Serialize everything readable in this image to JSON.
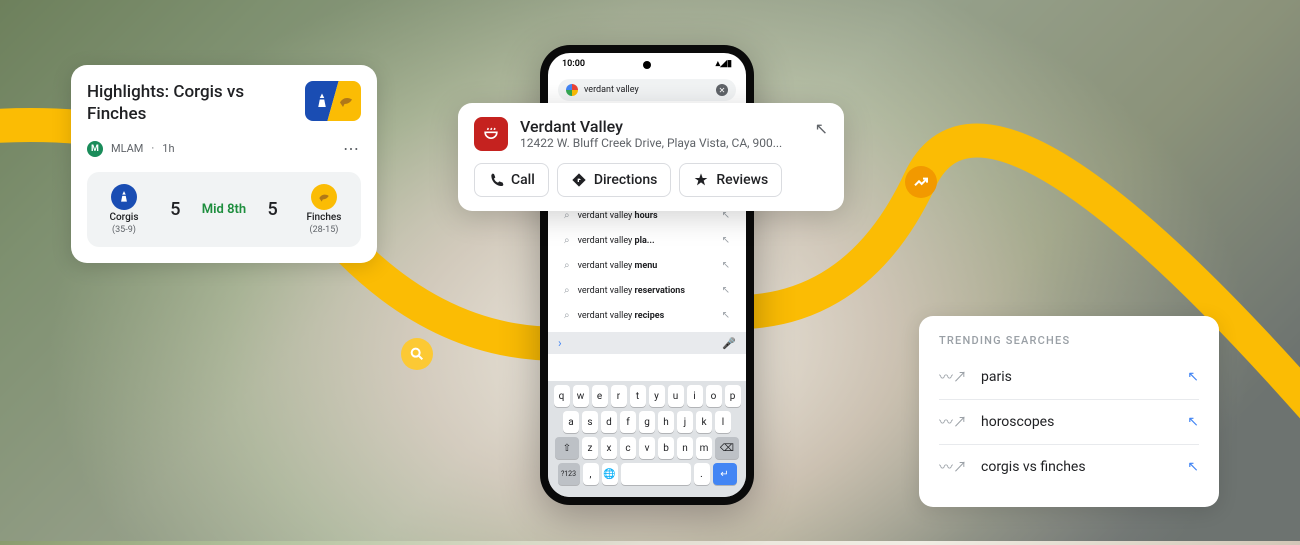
{
  "sports": {
    "title": "Highlights: Corgis vs Finches",
    "source": "MLAM",
    "time": "1h",
    "badge": "M",
    "status": "Mid 8th",
    "team1": {
      "name": "Corgis",
      "record": "(35-9)",
      "score": "5"
    },
    "team2": {
      "name": "Finches",
      "record": "(28-15)",
      "score": "5"
    }
  },
  "phone": {
    "time": "10:00",
    "search_value": "verdant valley",
    "suggestions": [
      {
        "prefix": "verdant valley ",
        "bold": "hours"
      },
      {
        "prefix": "verdant valley ",
        "bold": "pla..."
      },
      {
        "prefix": "verdant valley ",
        "bold": "menu"
      },
      {
        "prefix": "verdant valley ",
        "bold": "reservations"
      },
      {
        "prefix": "verdant valley ",
        "bold": "recipes"
      }
    ],
    "kb": {
      "r1": [
        "q",
        "w",
        "e",
        "r",
        "t",
        "y",
        "u",
        "i",
        "o",
        "p"
      ],
      "r2": [
        "a",
        "s",
        "d",
        "f",
        "g",
        "h",
        "j",
        "k",
        "l"
      ],
      "r3": [
        "z",
        "x",
        "c",
        "v",
        "b",
        "n",
        "m"
      ],
      "num": "?123"
    }
  },
  "place": {
    "name": "Verdant Valley",
    "address": "12422 W. Bluff Creek Drive, Playa Vista, CA, 900...",
    "actions": {
      "call": "Call",
      "directions": "Directions",
      "reviews": "Reviews"
    }
  },
  "trending": {
    "title": "TRENDING SEARCHES",
    "items": [
      "paris",
      "horoscopes",
      "corgis vs finches"
    ]
  }
}
